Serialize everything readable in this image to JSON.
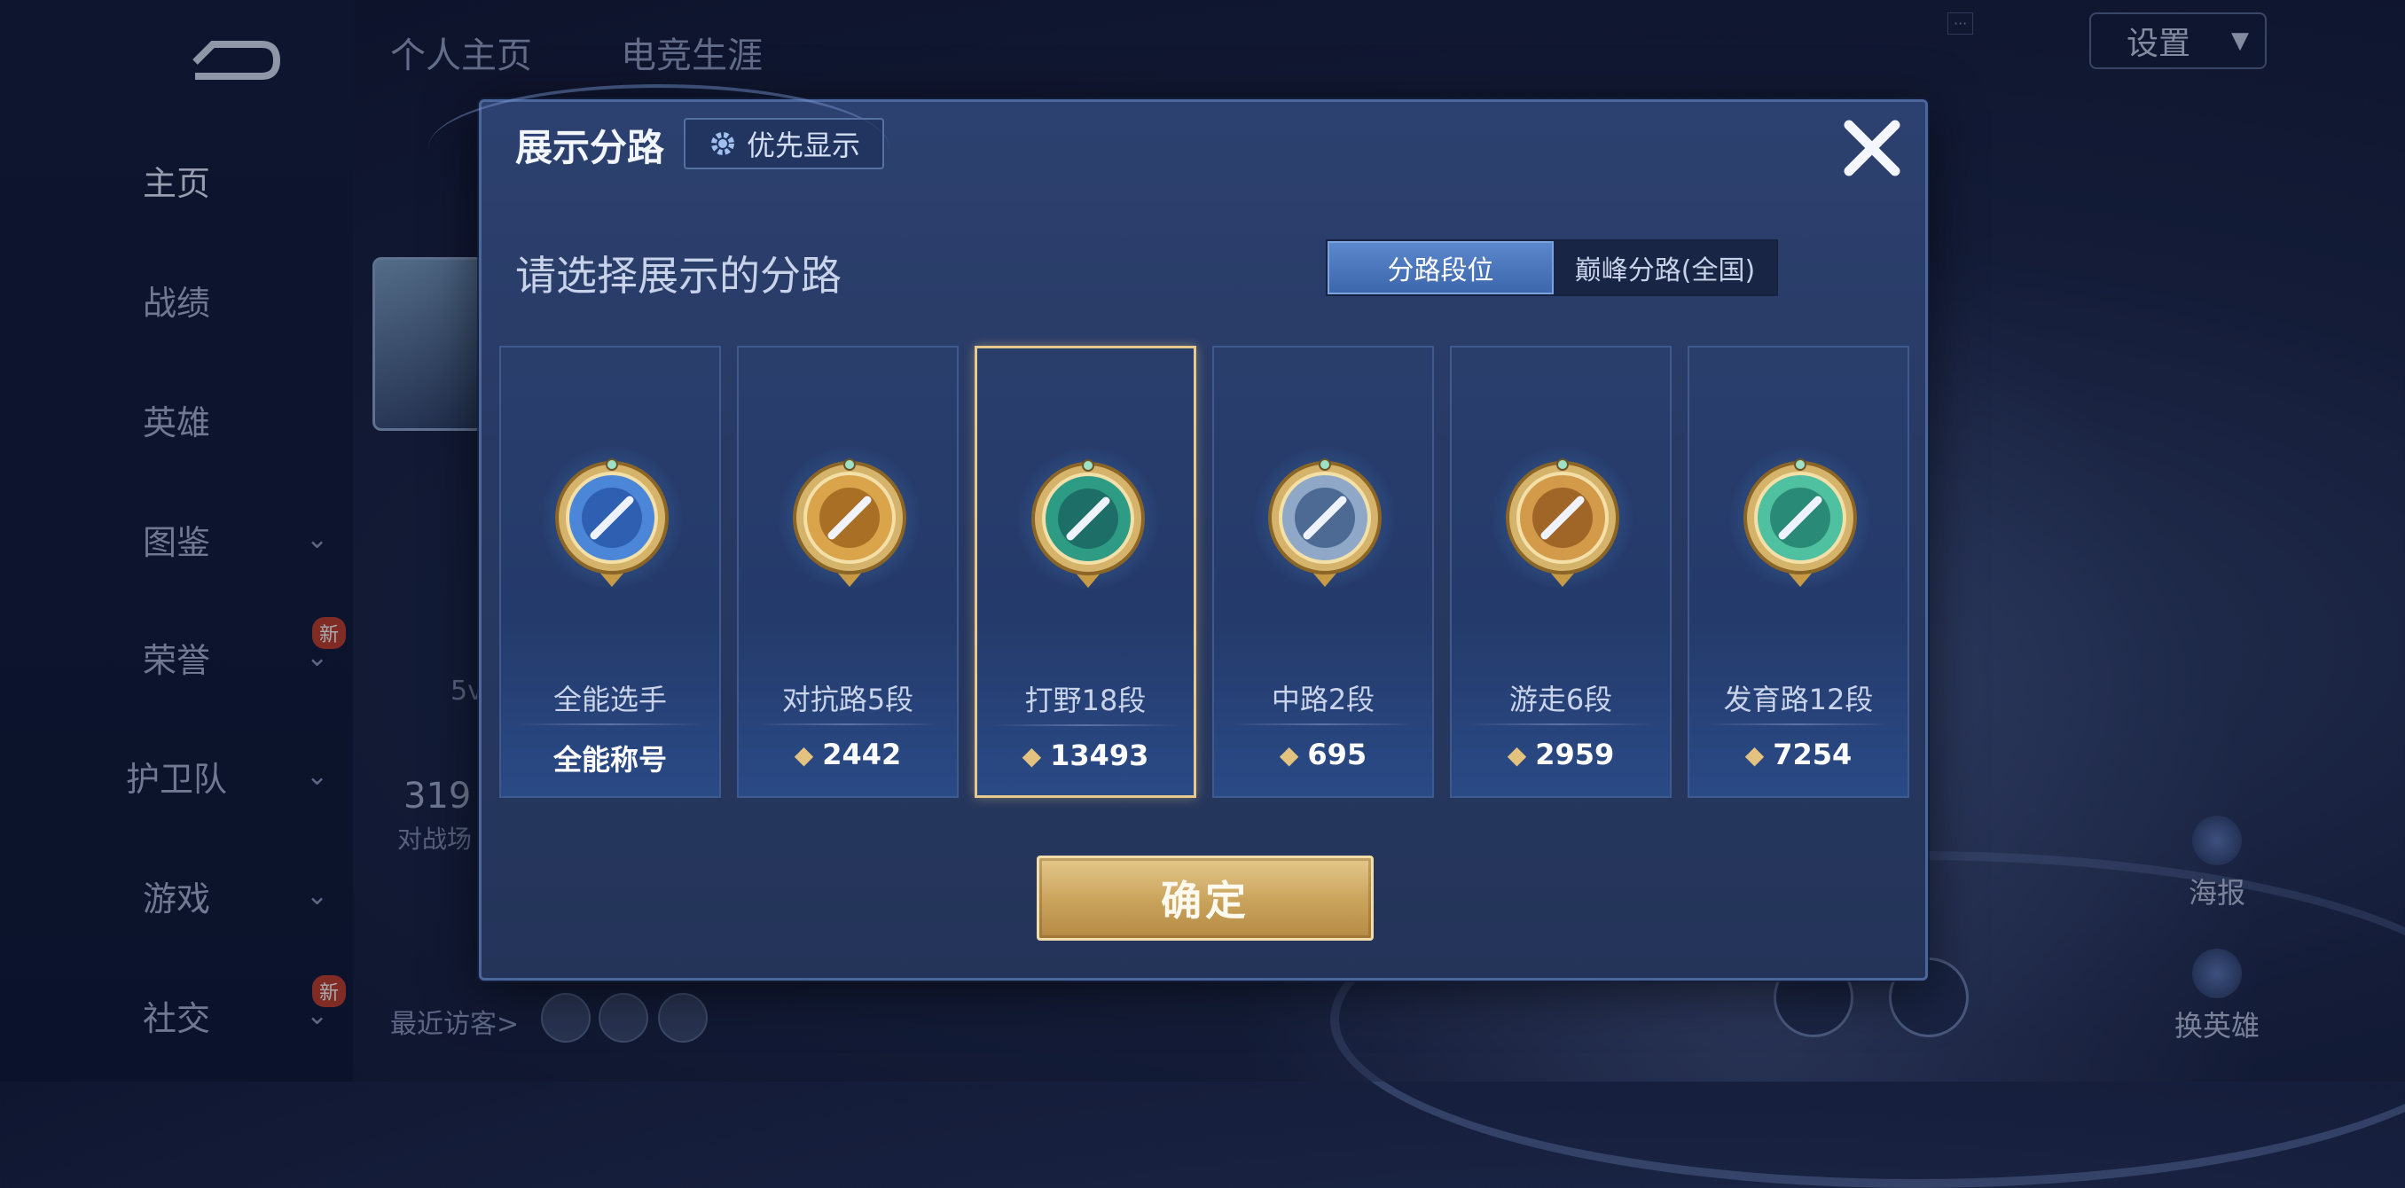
{
  "background": {
    "nav_items": [
      {
        "label": "主页",
        "active": true,
        "chevron": false,
        "new": false
      },
      {
        "label": "战绩",
        "active": false,
        "chevron": false,
        "new": false
      },
      {
        "label": "英雄",
        "active": false,
        "chevron": false,
        "new": false
      },
      {
        "label": "图鉴",
        "active": false,
        "chevron": true,
        "new": false
      },
      {
        "label": "荣誉",
        "active": false,
        "chevron": true,
        "new": true
      },
      {
        "label": "护卫队",
        "active": false,
        "chevron": true,
        "new": false
      },
      {
        "label": "游戏",
        "active": false,
        "chevron": true,
        "new": false
      },
      {
        "label": "社交",
        "active": false,
        "chevron": true,
        "new": true
      }
    ],
    "new_badge": "新",
    "tabs": [
      "个人主页",
      "电竞生涯"
    ],
    "settings_label": "设置",
    "right_buttons": [
      "海报",
      "换英雄"
    ],
    "recent_visitors_label": "最近访客>",
    "stat_number": "319",
    "stat_caption": "对战场",
    "bg_5v": "5v"
  },
  "modal": {
    "title": "展示分路",
    "priority_label": "优先显示",
    "section_title": "请选择展示的分路",
    "toggle_options": [
      "分路段位",
      "巅峰分路(全国)"
    ],
    "toggle_active_index": 0,
    "selected_index": 2,
    "cards": [
      {
        "name": "全能选手",
        "value": "全能称号",
        "has_gem": false,
        "badge": "all-round-badge-icon",
        "tint": "#4c86d8",
        "inner": "#2e5fb0"
      },
      {
        "name": "对抗路5段",
        "value": "2442",
        "has_gem": true,
        "badge": "clash-lane-badge-icon",
        "tint": "#d9a44a",
        "inner": "#a86f25"
      },
      {
        "name": "打野18段",
        "value": "13493",
        "has_gem": true,
        "badge": "jungle-badge-icon",
        "tint": "#2e9c84",
        "inner": "#1d6e66"
      },
      {
        "name": "中路2段",
        "value": "695",
        "has_gem": true,
        "badge": "mid-lane-badge-icon",
        "tint": "#8fa8c8",
        "inner": "#4d6a94"
      },
      {
        "name": "游走6段",
        "value": "2959",
        "has_gem": true,
        "badge": "roam-badge-icon",
        "tint": "#d39a4a",
        "inner": "#a06628"
      },
      {
        "name": "发育路12段",
        "value": "7254",
        "has_gem": true,
        "badge": "farm-lane-badge-icon",
        "tint": "#4fc0a0",
        "inner": "#2a8a78"
      }
    ],
    "confirm_label": "确定"
  }
}
